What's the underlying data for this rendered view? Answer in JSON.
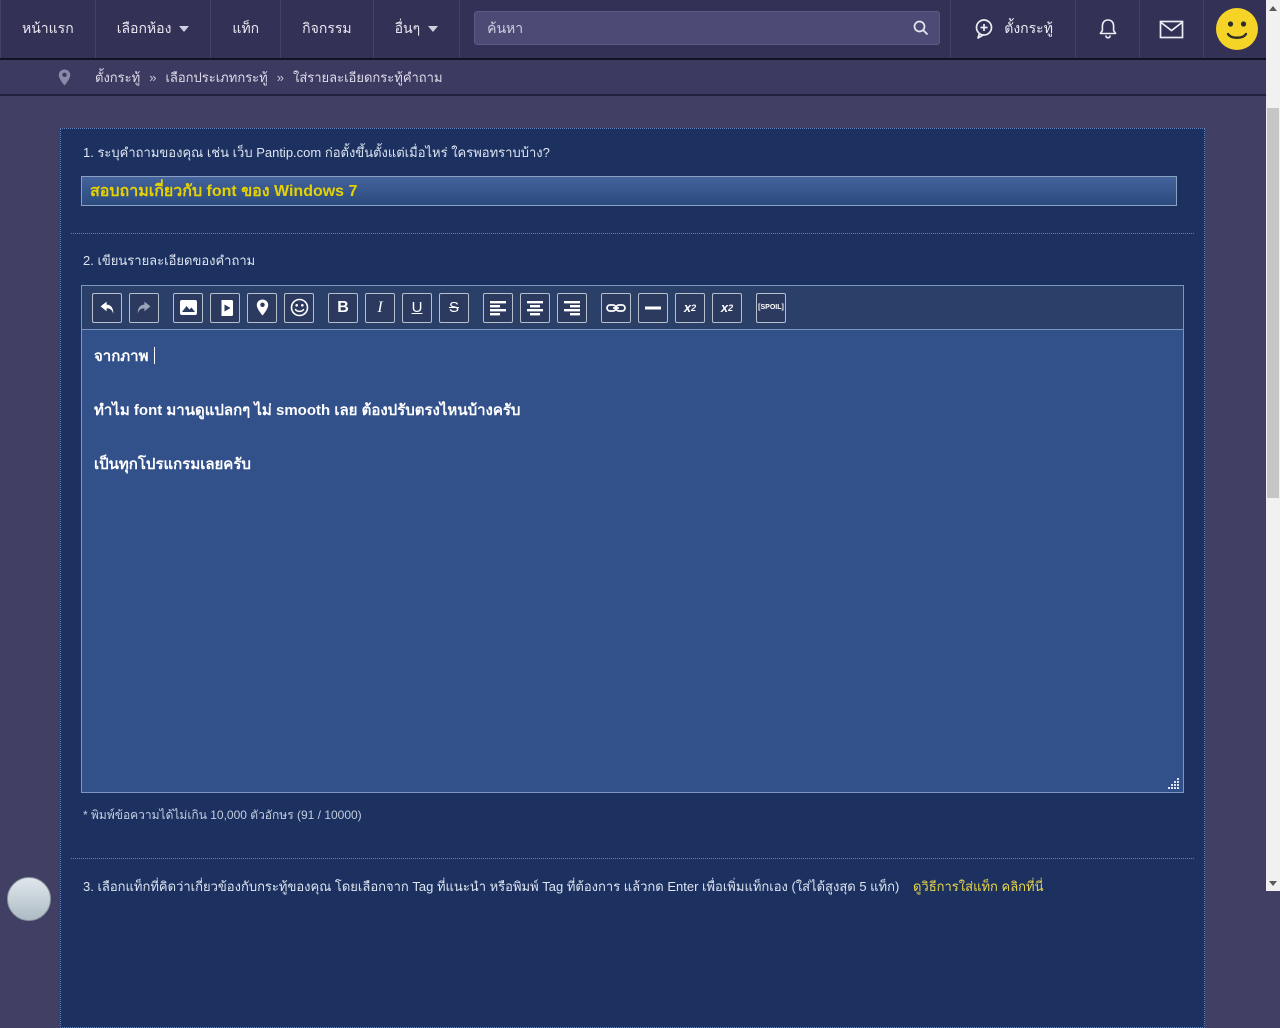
{
  "header": {
    "nav": [
      {
        "label": "หน้าแรก"
      },
      {
        "label": "เลือกห้อง"
      },
      {
        "label": "แท็ก"
      },
      {
        "label": "กิจกรรม"
      },
      {
        "label": "อื่นๆ"
      }
    ],
    "search_placeholder": "ค้นหา",
    "new_topic_label": "ตั้งกระทู้"
  },
  "breadcrumb": {
    "separator": "»",
    "items": [
      "ตั้งกระทู้",
      "เลือกประเภทกระทู้",
      "ใส่รายละเอียดกระทู้คำถาม"
    ]
  },
  "form": {
    "question1_label": "1. ระบุคำถามของคุณ เช่น เว็บ Pantip.com ก่อตั้งขึ้นตั้งแต่เมื่อไหร่ ใครพอทราบบ้าง?",
    "title_value": "สอบถามเกี่ยวกับ font ของ Windows 7",
    "question2_label": "2. เขียนรายละเอียดของคำถาม",
    "editor_lines": [
      "จากภาพ",
      "",
      "ทำไม font มานดูแปลกๆ ไม่ smooth เลย ต้องปรับตรงไหนบ้างครับ",
      "",
      "เป็นทุกโปรแกรมเลยครับ"
    ],
    "char_counter": "* พิมพ์ข้อความได้ไม่เกิน 10,000 ตัวอักษร (91 / 10000)",
    "question3_label": "3. เลือกแท็กที่คิดว่าเกี่ยวข้องกับกระทู้ของคุณ โดยเลือกจาก Tag ที่แนะนำ หรือพิมพ์ Tag ที่ต้องการ แล้วกด Enter เพื่อเพิ่มแท็กเอง (ใส่ได้สูงสุด 5 แท็ก)",
    "question3_link": "ดูวิธีการใส่แท็ก คลิกที่นี่"
  },
  "toolbar": {
    "bold": "B",
    "italic": "I",
    "underline": "U",
    "strike": "S",
    "sup_text": "x",
    "sup_mark": "2",
    "sub_text": "x",
    "sub_mark": "2",
    "spoiler": "[SPOIL]"
  },
  "colors": {
    "page_bg": "#413f63",
    "header_bg": "#343156",
    "breadcrumb_bg": "#3d3a62",
    "panel_bg": "#1c315f",
    "editor_bg": "#32508a",
    "title_text": "#e6d200",
    "link_yellow": "#e8d64a",
    "avatar_yellow": "#f5d327"
  }
}
